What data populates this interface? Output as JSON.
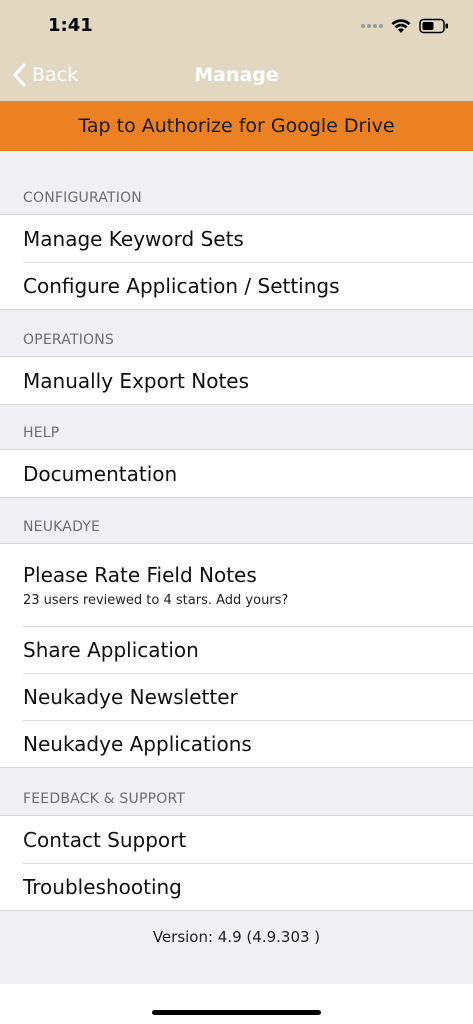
{
  "status": {
    "time": "1:41"
  },
  "nav": {
    "back_label": "Back",
    "title": "Manage"
  },
  "banner": {
    "label": "Tap to Authorize for Google Drive"
  },
  "sections": [
    {
      "header": "CONFIGURATION",
      "items": [
        {
          "label": "Manage Keyword Sets"
        },
        {
          "label": "Configure Application / Settings"
        }
      ]
    },
    {
      "header": "OPERATIONS",
      "items": [
        {
          "label": "Manually Export Notes"
        }
      ]
    },
    {
      "header": "HELP",
      "items": [
        {
          "label": "Documentation"
        }
      ]
    },
    {
      "header": "NEUKADYE",
      "items": [
        {
          "label": "Please Rate Field Notes",
          "sub": "23 users reviewed to 4 stars. Add yours?"
        },
        {
          "label": "Share Application"
        },
        {
          "label": "Neukadye Newsletter"
        },
        {
          "label": "Neukadye Applications"
        }
      ]
    },
    {
      "header": "FEEDBACK & SUPPORT",
      "items": [
        {
          "label": "Contact Support"
        },
        {
          "label": "Troubleshooting"
        }
      ]
    }
  ],
  "footer": {
    "version": "Version: 4.9 (4.9.303 )"
  },
  "colors": {
    "nav_bg": "#e2d8c2",
    "banner_bg": "#ec8123",
    "page_bg": "#efeff4"
  },
  "icons": [
    "wifi-icon",
    "battery-icon",
    "chevron-left-icon"
  ]
}
